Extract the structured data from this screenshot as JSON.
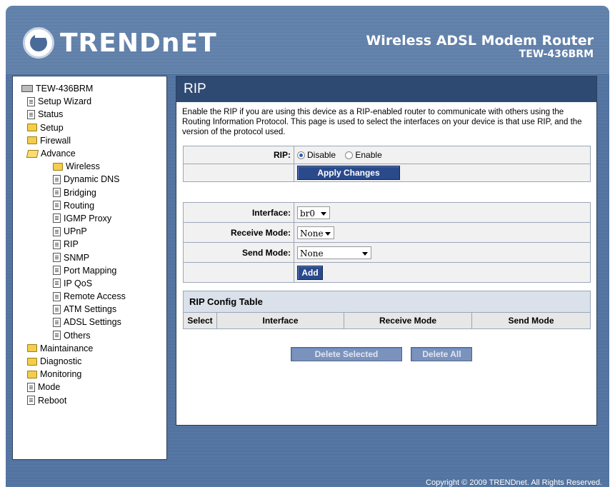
{
  "header": {
    "brand": "TRENDnET",
    "product_line": "Wireless ADSL Modem Router",
    "model": "TEW-436BRM"
  },
  "nav": {
    "items": [
      {
        "label": "TEW-436BRM",
        "icon": "router-root-icon",
        "level": 0
      },
      {
        "label": "Setup Wizard",
        "icon": "page-icon",
        "level": 1
      },
      {
        "label": "Status",
        "icon": "page-icon",
        "level": 1
      },
      {
        "label": "Setup",
        "icon": "folder-icon",
        "level": 1
      },
      {
        "label": "Firewall",
        "icon": "folder-icon",
        "level": 1
      },
      {
        "label": "Advance",
        "icon": "folder-open-icon",
        "level": 1
      },
      {
        "label": "Wireless",
        "icon": "folder-icon",
        "level": 2
      },
      {
        "label": "Dynamic DNS",
        "icon": "page-icon",
        "level": 2
      },
      {
        "label": "Bridging",
        "icon": "page-icon",
        "level": 2
      },
      {
        "label": "Routing",
        "icon": "page-icon",
        "level": 2
      },
      {
        "label": "IGMP Proxy",
        "icon": "page-icon",
        "level": 2
      },
      {
        "label": "UPnP",
        "icon": "page-icon",
        "level": 2
      },
      {
        "label": "RIP",
        "icon": "page-icon",
        "level": 2
      },
      {
        "label": "SNMP",
        "icon": "page-icon",
        "level": 2
      },
      {
        "label": "Port Mapping",
        "icon": "page-icon",
        "level": 2
      },
      {
        "label": "IP QoS",
        "icon": "page-icon",
        "level": 2
      },
      {
        "label": "Remote Access",
        "icon": "page-icon",
        "level": 2
      },
      {
        "label": "ATM Settings",
        "icon": "page-icon",
        "level": 2
      },
      {
        "label": "ADSL Settings",
        "icon": "page-icon",
        "level": 2
      },
      {
        "label": "Others",
        "icon": "page-icon",
        "level": 2
      },
      {
        "label": "Maintainance",
        "icon": "folder-icon",
        "level": 1
      },
      {
        "label": "Diagnostic",
        "icon": "folder-icon",
        "level": 1
      },
      {
        "label": "Monitoring",
        "icon": "folder-icon",
        "level": 1
      },
      {
        "label": "Mode",
        "icon": "page-icon",
        "level": 1
      },
      {
        "label": "Reboot",
        "icon": "page-icon",
        "level": 1
      }
    ]
  },
  "main": {
    "title": "RIP",
    "description": "Enable the RIP if you are using this device as a RIP-enabled router to communicate with others using the Routing Information Protocol. This page is used to select the interfaces on your device is that use RIP, and the version of the protocol used.",
    "rip_label": "RIP:",
    "rip_disable": "Disable",
    "rip_enable": "Enable",
    "rip_selected": "Disable",
    "apply_button": "Apply Changes",
    "interface_label": "Interface:",
    "interface_value": "br0",
    "receive_mode_label": "Receive Mode:",
    "receive_mode_value": "None",
    "send_mode_label": "Send Mode:",
    "send_mode_value": "None",
    "add_button": "Add",
    "config_table": {
      "caption": "RIP Config Table",
      "columns": [
        "Select",
        "Interface",
        "Receive Mode",
        "Send Mode"
      ],
      "rows": []
    },
    "delete_selected_button": "Delete Selected",
    "delete_all_button": "Delete All"
  },
  "footer": {
    "copyright": "Copyright © 2009 TRENDnet. All Rights Reserved."
  },
  "colors": {
    "title_bar": "#2f4a72",
    "button": "#2a4a8c",
    "frame": "#4a6b98"
  }
}
